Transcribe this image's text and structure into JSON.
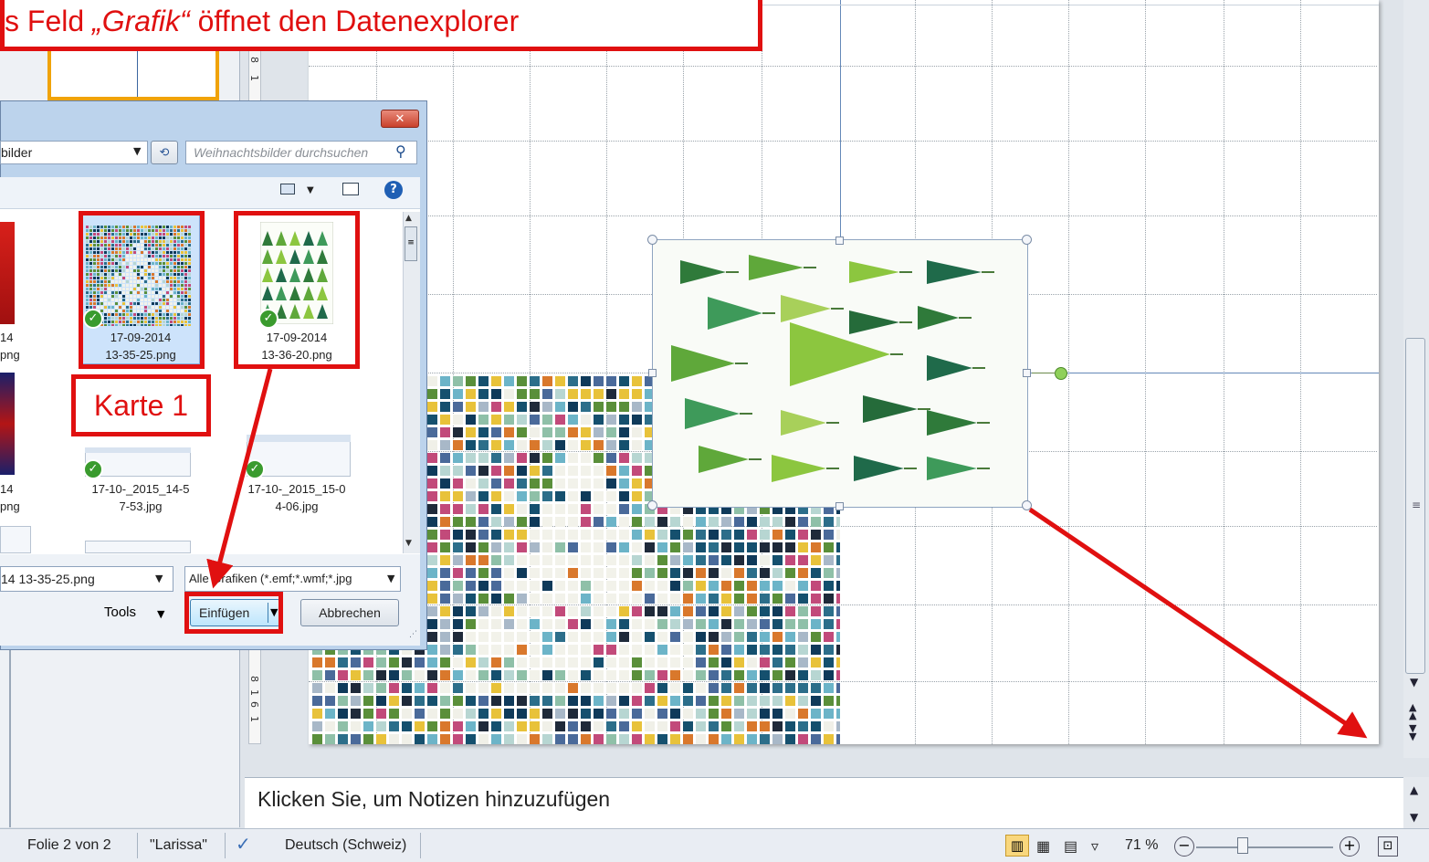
{
  "banner": {
    "prefix": "s Feld ",
    "emphasis": "„Grafik“",
    "suffix": " öffnet den Datenexplorer"
  },
  "ruler_labels": [
    "8",
    "1",
    "8",
    "1",
    "6",
    "1"
  ],
  "dialog": {
    "address_fragment": "bilder",
    "search_placeholder": "Weihnachtsbilder durchsuchen",
    "files": [
      {
        "name_line1": "14",
        "name_line2": "png"
      },
      {
        "name_line1": "17-09-2014",
        "name_line2": "13-35-25.png"
      },
      {
        "name_line1": "17-09-2014",
        "name_line2": "13-36-20.png"
      },
      {
        "name_line1": "14",
        "name_line2": "png"
      },
      {
        "name_line1": "17-10-_2015_14-5",
        "name_line2": "7-53.jpg"
      },
      {
        "name_line1": "17-10-_2015_15-0",
        "name_line2": "4-06.jpg"
      }
    ],
    "filename_value": "14 13-35-25.png",
    "filetype_value": "Alle Grafiken (*.emf;*.wmf;*.jpg",
    "tools_label": "Tools",
    "insert_label": "Einfügen",
    "cancel_label": "Abbrechen"
  },
  "annotation": {
    "card_label": "Karte 1"
  },
  "notes_placeholder": "Klicken Sie, um Notizen hinzuzufügen",
  "statusbar": {
    "slide_info": "Folie 2 von 2",
    "theme": "\"Larissa\"",
    "language": "Deutsch (Schweiz)",
    "zoom": "71 %"
  },
  "colors": {
    "annotation_red": "#e01010",
    "thumbnail_highlight": "#f0a30a",
    "selection_blue": "#cde3fb"
  }
}
